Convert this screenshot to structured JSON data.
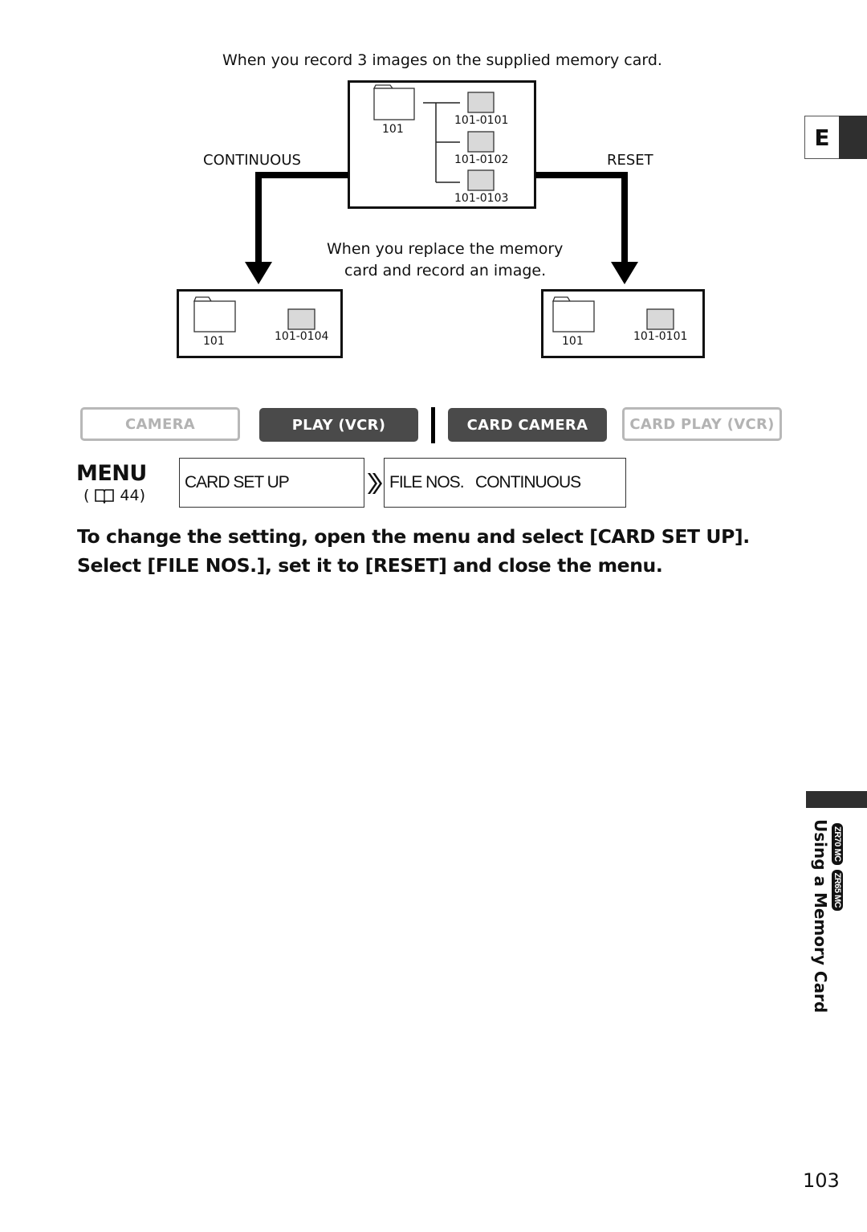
{
  "diagram": {
    "top_caption": "When you record 3 images on the supplied memory card.",
    "left_branch_label": "CONTINUOUS",
    "right_branch_label": "RESET",
    "middle_caption_line1": "When you replace the memory",
    "middle_caption_line2": "card and record an image.",
    "top_box": {
      "folder": "101",
      "files": [
        "101-0101",
        "101-0102",
        "101-0103"
      ]
    },
    "left_box": {
      "folder": "101",
      "file": "101-0104"
    },
    "right_box": {
      "folder": "101",
      "file": "101-0101"
    }
  },
  "modes": [
    {
      "label": "CAMERA",
      "active": false
    },
    {
      "label": "PLAY (VCR)",
      "active": true
    },
    {
      "label": "CARD CAMERA",
      "active": true
    },
    {
      "label": "CARD PLAY (VCR)",
      "active": false
    }
  ],
  "menu": {
    "title": "MENU",
    "ref_icon": "book-icon",
    "ref_page": "44)",
    "ref_open": "(",
    "step1": "CARD SET UP",
    "step2": "FILE NOS.   CONTINUOUS"
  },
  "instructions": "To change the setting, open the menu and select [CARD SET UP]. Select [FILE NOS.], set it to [RESET] and close the menu.",
  "side": {
    "language": "E",
    "section_title": "Using a Memory Card",
    "badges": [
      "ZR70 MC",
      "ZR65 MC"
    ]
  },
  "page_number": "103"
}
